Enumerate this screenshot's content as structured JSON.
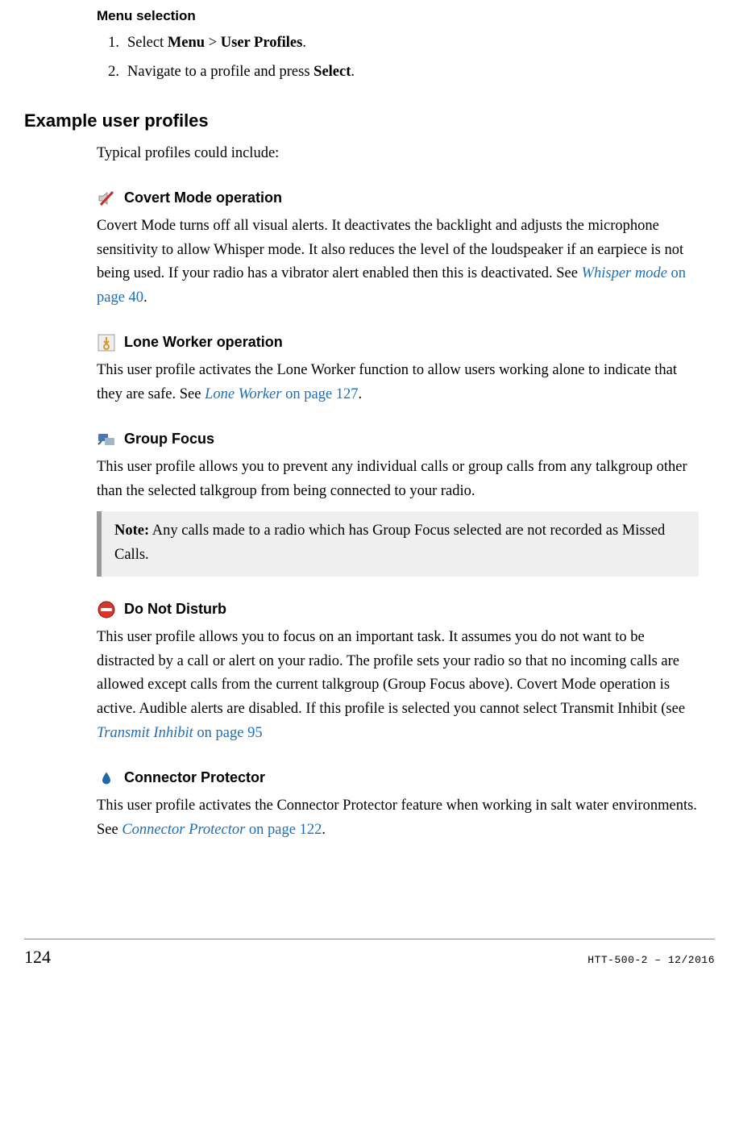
{
  "menu_sel": {
    "heading": "Menu selection",
    "steps": [
      {
        "num": "1.",
        "pre": "Select ",
        "b1": "Menu",
        "mid": " > ",
        "b2": "User Profiles",
        "post": "."
      },
      {
        "num": "2.",
        "pre": "Navigate to a profile and press ",
        "b1": "Select",
        "mid": "",
        "b2": "",
        "post": "."
      }
    ]
  },
  "example": {
    "heading": "Example user profiles",
    "intro": "Typical profiles could include:"
  },
  "covert": {
    "title": "Covert Mode operation",
    "body_pre": "Covert Mode turns off all visual alerts. It deactivates the backlight and adjusts the microphone sensitivity to allow Whisper mode. It also reduces the level of the loudspeaker if an earpiece is not being used. If your radio has a vibrator alert enabled then this is deactivated. See ",
    "link_i": "Whisper mode",
    "link_t": " on page 40",
    "body_post": "."
  },
  "lone": {
    "title": "Lone Worker operation",
    "body_pre": "This user profile activates the Lone Worker function to allow users working alone to indicate that they are safe. See ",
    "link_i": "Lone Worker",
    "link_t": " on page 127",
    "body_post": "."
  },
  "group": {
    "title": "Group Focus",
    "body": "This user profile allows you to prevent any individual calls or group calls from any talkgroup other than the selected talkgroup from being connected to your radio.",
    "note_label": "Note:",
    "note_body": "  Any calls made to a radio which has Group Focus selected are not recorded as Missed Calls."
  },
  "dnd": {
    "title": "Do Not Disturb",
    "body_pre": "This user profile allows you to focus on an important task. It assumes you do not want to be distracted by a call or alert on your radio. The profile sets your radio so that no incoming calls are allowed except calls from the current talkgroup (Group Focus above). Covert Mode operation is active. Audible alerts are disabled. If this profile is selected you cannot select Transmit Inhibit (see ",
    "link_i": "Transmit Inhibit",
    "link_t": "  on page 95",
    "body_post": ""
  },
  "conn": {
    "title": "Connector Protector",
    "body_pre": "This user profile activates the Connector Protector feature when working in salt water environments. See ",
    "link_i": "Connector Protector",
    "link_t": "  on page 122",
    "body_post": "."
  },
  "footer": {
    "page": "124",
    "docid": "HTT-500-2 – 12/2016"
  }
}
